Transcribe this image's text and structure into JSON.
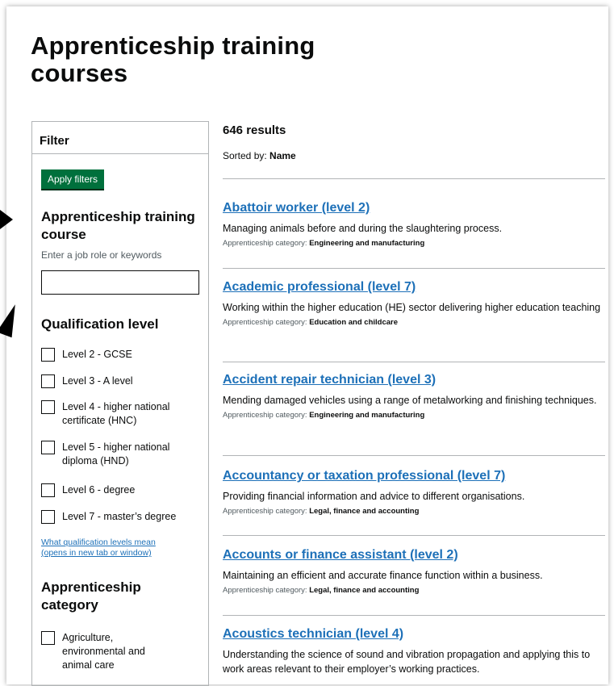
{
  "page": {
    "title": "Apprenticeship training courses"
  },
  "filter": {
    "heading": "Filter",
    "apply_label": "Apply filters",
    "course": {
      "title": "Apprenticeship training course",
      "hint": "Enter a job role or keywords",
      "value": ""
    },
    "qualification": {
      "title": "Qualification level",
      "options": [
        {
          "label": "Level 2 - GCSE",
          "checked": false
        },
        {
          "label": "Level 3 - A level",
          "checked": false
        },
        {
          "label": "Level 4 - higher national certificate (HNC)",
          "checked": false
        },
        {
          "label": "Level 5 - higher national diploma (HND)",
          "checked": false
        },
        {
          "label": "Level 6 - degree",
          "checked": false
        },
        {
          "label": "Level 7 - master’s degree",
          "checked": false
        }
      ],
      "help_link": "What qualification levels mean (opens in new tab or window)"
    },
    "category": {
      "title": "Apprenticeship category",
      "options": [
        {
          "label": "Agriculture, environmental and animal care",
          "checked": false
        }
      ]
    }
  },
  "results": {
    "count_label": "646 results",
    "sorted_prefix": "Sorted by:",
    "sorted_value": "Name",
    "category_prefix": "Apprenticeship category:",
    "items": [
      {
        "title": "Abattoir worker (level 2)",
        "description": "Managing animals before and during the slaughtering process.",
        "category": "Engineering and manufacturing"
      },
      {
        "title": "Academic professional (level 7)",
        "description": "Working within the higher education (HE) sector delivering higher education teaching",
        "category": "Education and childcare"
      },
      {
        "title": "Accident repair technician (level 3)",
        "description": "Mending damaged vehicles using a range of metalworking and finishing techniques.",
        "category": "Engineering and manufacturing"
      },
      {
        "title": "Accountancy or taxation professional (level 7)",
        "description": "Providing financial information and advice to different organisations.",
        "category": "Legal, finance and accounting"
      },
      {
        "title": "Accounts or finance assistant (level 2)",
        "description": "Maintaining an efficient and accurate finance function within a business.",
        "category": "Legal, finance and accounting"
      },
      {
        "title": "Acoustics technician (level 4)",
        "description": "Understanding the science of sound and vibration propagation and applying this to work areas relevant to their employer’s working practices.",
        "category": ""
      }
    ]
  },
  "colors": {
    "link": "#1d70b8",
    "button": "#00703c",
    "text": "#0b0c0c",
    "border": "#b1b4b6"
  }
}
